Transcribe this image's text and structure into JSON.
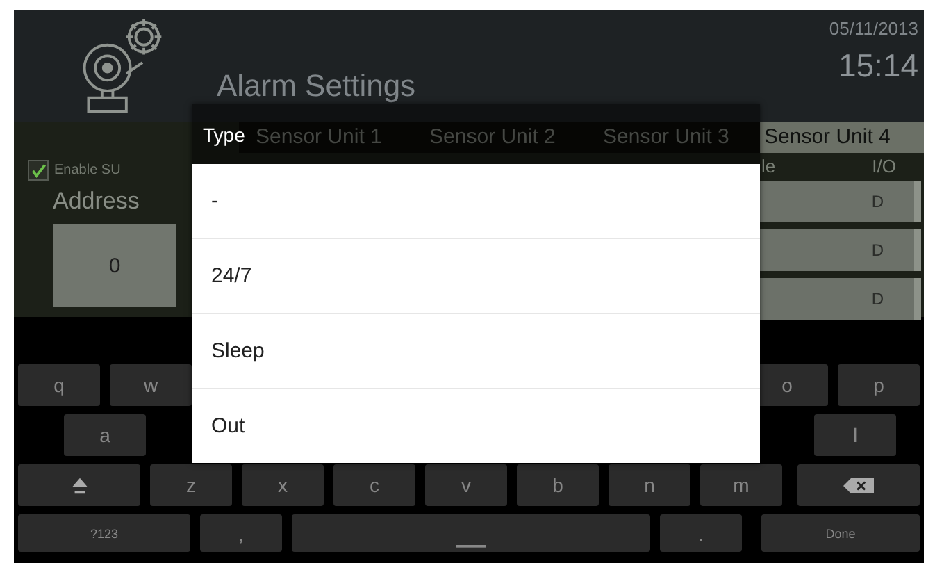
{
  "header": {
    "title": "Alarm Settings",
    "date": "05/11/2013",
    "time": "15:14"
  },
  "tabs": [
    {
      "label": "Sensor Unit 1",
      "selected": false
    },
    {
      "label": "Sensor Unit 2",
      "selected": false
    },
    {
      "label": "Sensor Unit 3",
      "selected": false
    },
    {
      "label": "Sensor Unit 4",
      "selected": true
    }
  ],
  "enable": {
    "label": "Enable SU",
    "checked": true
  },
  "address": {
    "label": "Address",
    "value": "0"
  },
  "table": {
    "columns": [
      "le",
      "I/O"
    ],
    "rows": [
      "D",
      "D",
      "D"
    ]
  },
  "dialog": {
    "title": "Type",
    "options": [
      "-",
      "24/7",
      "Sleep",
      "Out"
    ]
  },
  "keyboard": {
    "rows": [
      {
        "left": [
          {
            "kind": "char",
            "label": "q"
          },
          {
            "kind": "char",
            "label": "w"
          }
        ],
        "right": [
          {
            "kind": "char",
            "label": "o"
          },
          {
            "kind": "char",
            "label": "p"
          }
        ]
      },
      {
        "left": [
          {
            "kind": "char",
            "label": "a"
          }
        ],
        "right": [
          {
            "kind": "char",
            "label": "l"
          }
        ]
      },
      {
        "left": [
          {
            "kind": "shift"
          },
          {
            "kind": "char",
            "label": "z"
          },
          {
            "kind": "char",
            "label": "x"
          },
          {
            "kind": "char",
            "label": "c"
          },
          {
            "kind": "char",
            "label": "v"
          },
          {
            "kind": "char",
            "label": "b"
          },
          {
            "kind": "char",
            "label": "n"
          },
          {
            "kind": "char",
            "label": "m"
          }
        ],
        "right": [
          {
            "kind": "backspace"
          }
        ]
      },
      {
        "left": [
          {
            "kind": "mode",
            "label": "?123"
          },
          {
            "kind": "char",
            "label": ","
          },
          {
            "kind": "space"
          },
          {
            "kind": "char",
            "label": "."
          }
        ],
        "right": [
          {
            "kind": "done",
            "label": "Done"
          }
        ]
      }
    ]
  }
}
